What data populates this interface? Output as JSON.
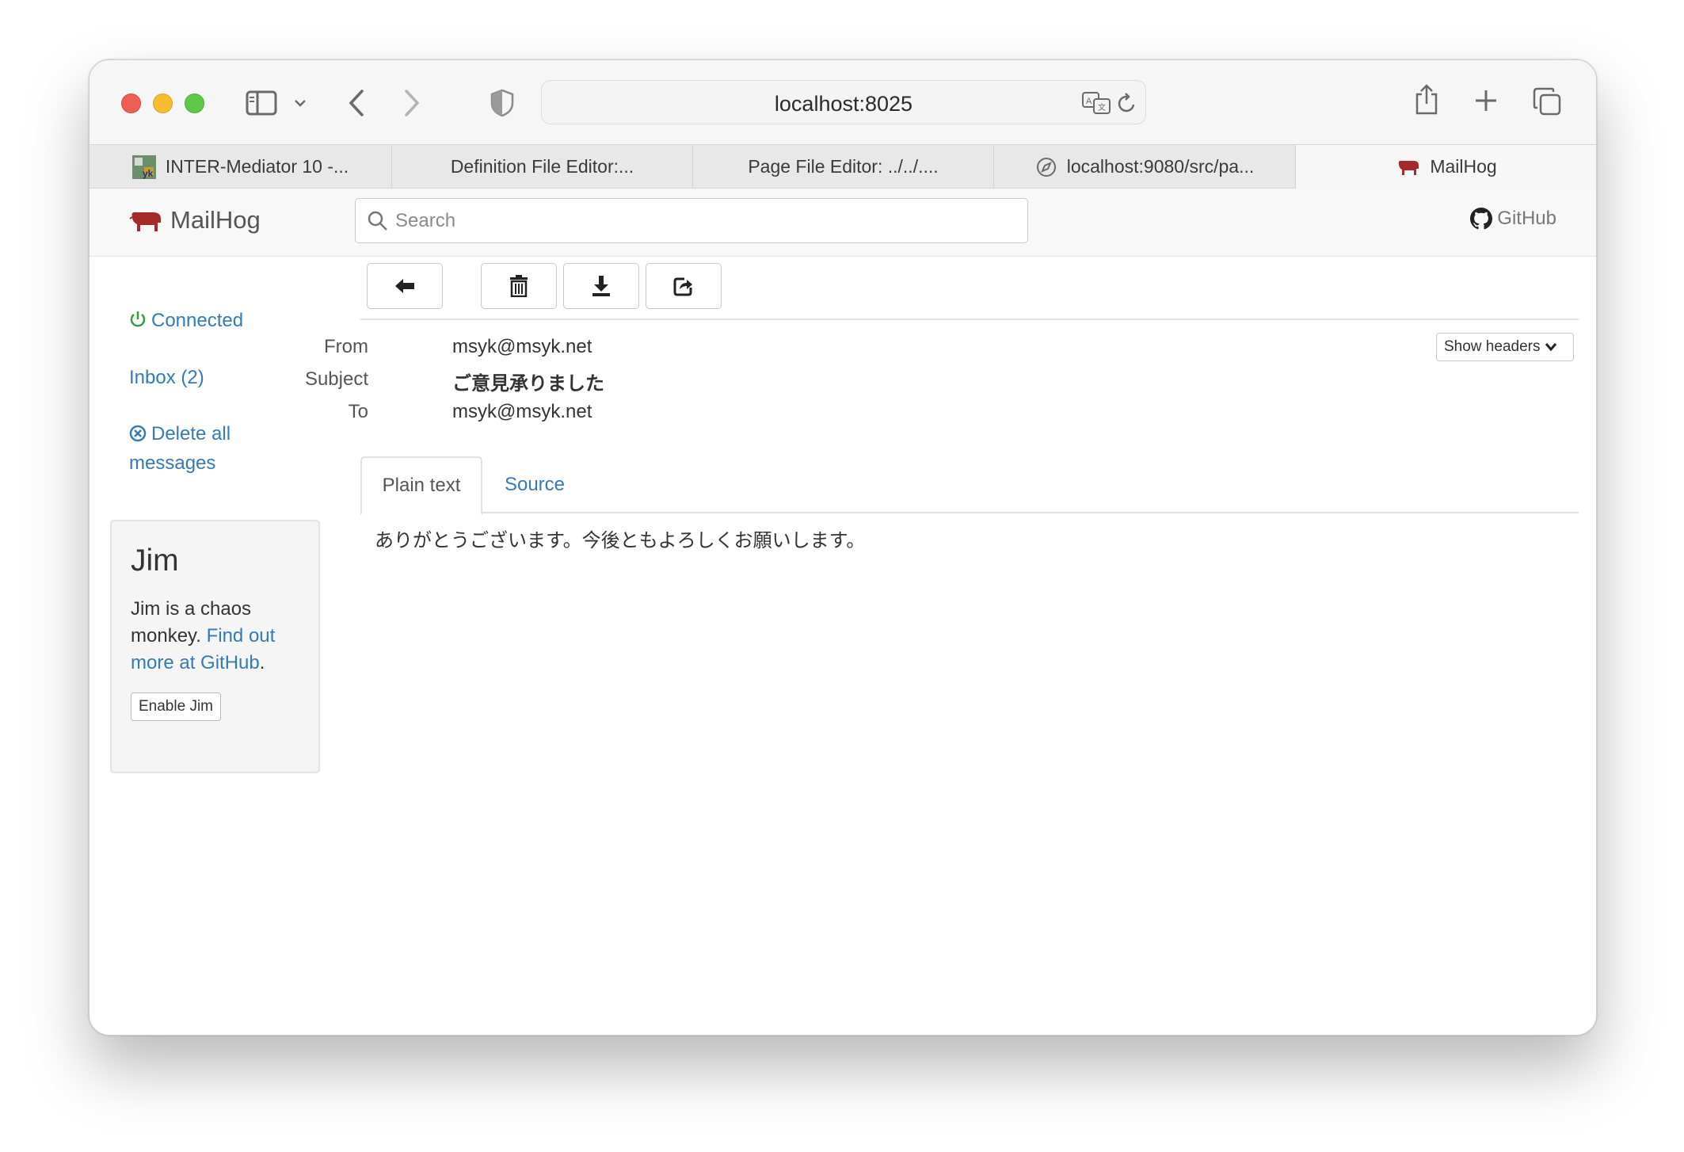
{
  "browser": {
    "address": "localhost:8025",
    "tabs": [
      {
        "label": "INTER-Mediator 10 -..."
      },
      {
        "label": "Definition File Editor:..."
      },
      {
        "label": "Page File Editor: ../../...."
      },
      {
        "label": "localhost:9080/src/pa..."
      },
      {
        "label": "MailHog"
      }
    ]
  },
  "header": {
    "brand": "MailHog",
    "search_placeholder": "Search",
    "github_label": "GitHub"
  },
  "sidebar": {
    "connected": "Connected",
    "inbox": "Inbox (2)",
    "delete_all": "Delete all messages"
  },
  "jim": {
    "title": "Jim",
    "text": "Jim is a chaos monkey.",
    "link_text": "Find out more at GitHub",
    "period": ".",
    "button": "Enable Jim"
  },
  "message": {
    "from_label": "From",
    "from": "msyk@msyk.net",
    "subject_label": "Subject",
    "subject": "ご意見承りました",
    "to_label": "To",
    "to": "msyk@msyk.net",
    "show_headers": "Show headers",
    "tabs": {
      "plain": "Plain text",
      "source": "Source"
    },
    "body": "ありがとうございます。今後ともよろしくお願いします。"
  },
  "colors": {
    "link": "#337ab7",
    "connected": "#3c9a3c",
    "brand_pig": "#a52a2a"
  }
}
